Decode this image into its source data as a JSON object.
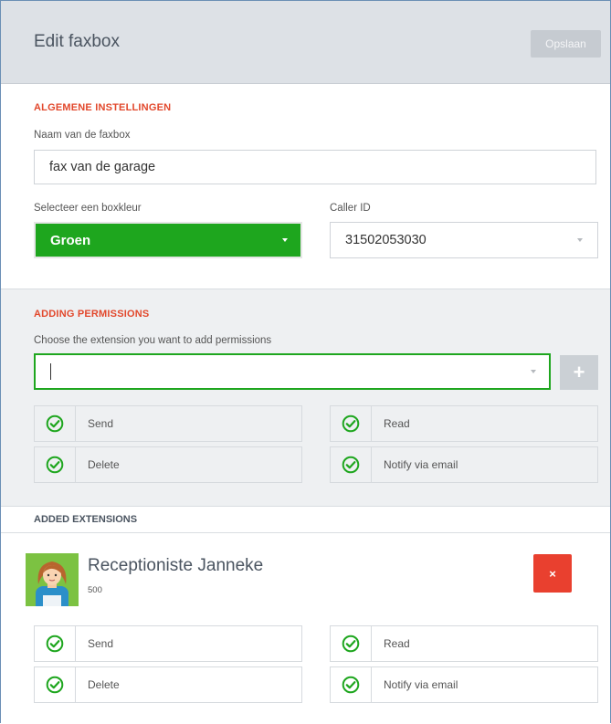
{
  "header": {
    "title": "Edit faxbox",
    "save_label": "Opslaan"
  },
  "general": {
    "section_title": "ALGEMENE INSTELLINGEN",
    "name_label": "Naam van de faxbox",
    "name_value": "fax van de garage",
    "color_label": "Selecteer een boxkleur",
    "color_value": "Groen",
    "caller_label": "Caller ID",
    "caller_value": "31502053030"
  },
  "permissions": {
    "section_title": "ADDING PERMISSIONS",
    "choose_label": "Choose the extension you want to add permissions",
    "search_value": "",
    "add_button": "+",
    "items": [
      "Send",
      "Read",
      "Delete",
      "Notify via email"
    ]
  },
  "added": {
    "section_title": "ADDED EXTENSIONS",
    "users": [
      {
        "name": "Receptioniste Janneke",
        "extension": "500",
        "remove_label": "×",
        "permissions": [
          "Send",
          "Read",
          "Delete",
          "Notify via email"
        ]
      }
    ]
  },
  "colors": {
    "accent_red": "#e2482c",
    "green": "#1ea61e",
    "remove_red": "#e9402f"
  }
}
